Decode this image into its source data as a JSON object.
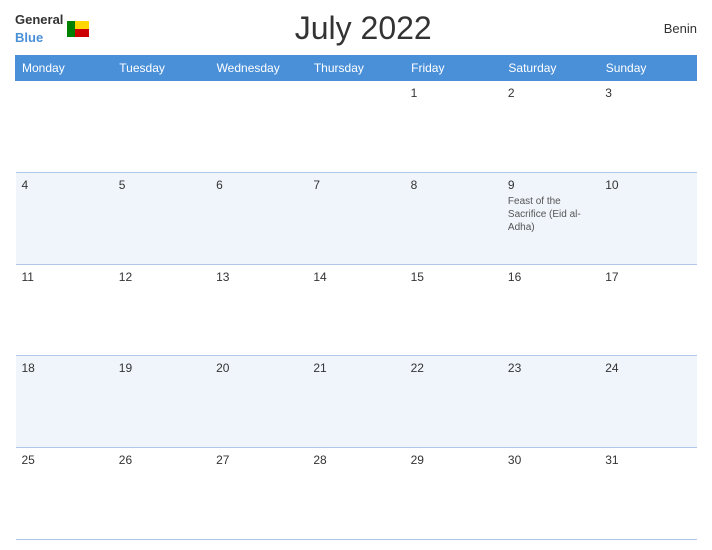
{
  "header": {
    "logo_general": "General",
    "logo_blue": "Blue",
    "title": "July 2022",
    "country": "Benin"
  },
  "days_of_week": [
    "Monday",
    "Tuesday",
    "Wednesday",
    "Thursday",
    "Friday",
    "Saturday",
    "Sunday"
  ],
  "weeks": [
    [
      {
        "day": "",
        "event": ""
      },
      {
        "day": "",
        "event": ""
      },
      {
        "day": "",
        "event": ""
      },
      {
        "day": "",
        "event": ""
      },
      {
        "day": "1",
        "event": ""
      },
      {
        "day": "2",
        "event": ""
      },
      {
        "day": "3",
        "event": ""
      }
    ],
    [
      {
        "day": "4",
        "event": ""
      },
      {
        "day": "5",
        "event": ""
      },
      {
        "day": "6",
        "event": ""
      },
      {
        "day": "7",
        "event": ""
      },
      {
        "day": "8",
        "event": ""
      },
      {
        "day": "9",
        "event": "Feast of the Sacrifice (Eid al-Adha)"
      },
      {
        "day": "10",
        "event": ""
      }
    ],
    [
      {
        "day": "11",
        "event": ""
      },
      {
        "day": "12",
        "event": ""
      },
      {
        "day": "13",
        "event": ""
      },
      {
        "day": "14",
        "event": ""
      },
      {
        "day": "15",
        "event": ""
      },
      {
        "day": "16",
        "event": ""
      },
      {
        "day": "17",
        "event": ""
      }
    ],
    [
      {
        "day": "18",
        "event": ""
      },
      {
        "day": "19",
        "event": ""
      },
      {
        "day": "20",
        "event": ""
      },
      {
        "day": "21",
        "event": ""
      },
      {
        "day": "22",
        "event": ""
      },
      {
        "day": "23",
        "event": ""
      },
      {
        "day": "24",
        "event": ""
      }
    ],
    [
      {
        "day": "25",
        "event": ""
      },
      {
        "day": "26",
        "event": ""
      },
      {
        "day": "27",
        "event": ""
      },
      {
        "day": "28",
        "event": ""
      },
      {
        "day": "29",
        "event": ""
      },
      {
        "day": "30",
        "event": ""
      },
      {
        "day": "31",
        "event": ""
      }
    ]
  ]
}
